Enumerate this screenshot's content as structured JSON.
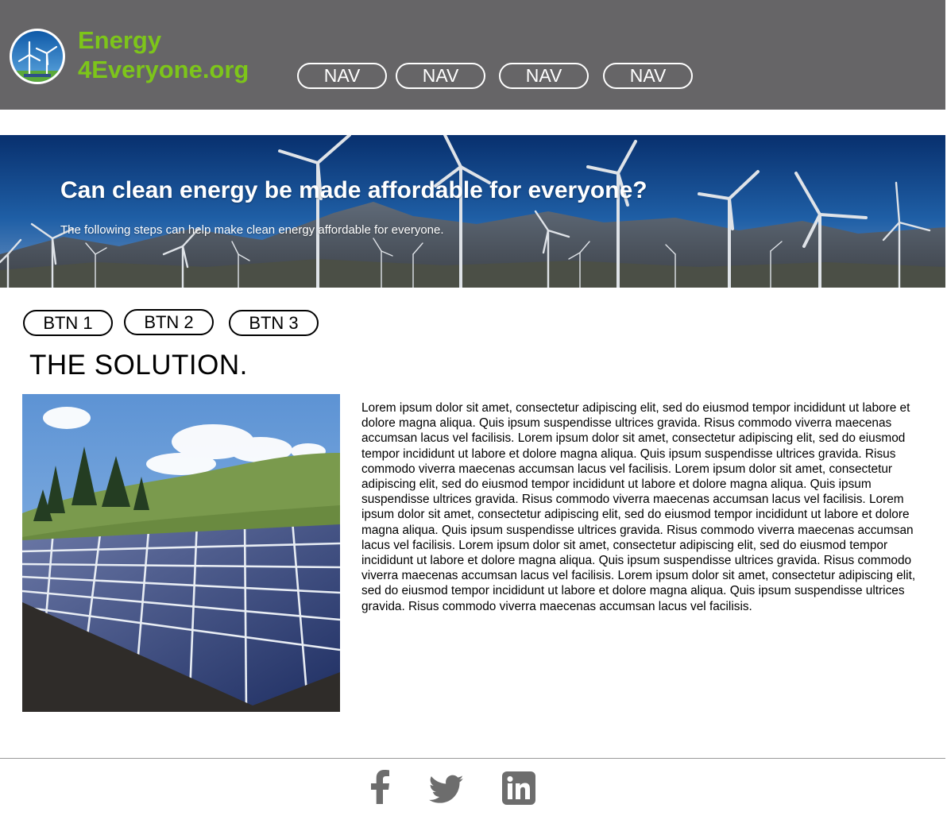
{
  "header": {
    "brand_line1": "Energy",
    "brand_line2": "4Everyone.org",
    "brand_color": "#7dc51a",
    "background": "#666567",
    "nav": [
      "NAV",
      "NAV",
      "NAV",
      "NAV"
    ]
  },
  "hero": {
    "title": "Can clean energy be made affordable for everyone?",
    "subtitle": "The following steps can help make clean energy affordable for everyone."
  },
  "buttons": [
    "BTN 1",
    "BTN 2",
    "BTN 3"
  ],
  "section": {
    "title": "THE SOLUTION.",
    "body": "Lorem ipsum dolor sit amet, consectetur adipiscing elit, sed do eiusmod tempor incididunt ut labore et dolore magna aliqua. Quis ipsum suspendisse ultrices gravida. Risus commodo viverra maecenas accumsan lacus vel facilisis. Lorem ipsum dolor sit amet, consectetur adipiscing elit, sed do eiusmod tempor incididunt ut labore et dolore magna aliqua. Quis ipsum suspendisse ultrices gravida. Risus commodo viverra maecenas accumsan lacus vel facilisis. Lorem ipsum dolor sit amet, consectetur adipiscing elit, sed do eiusmod tempor incididunt ut labore et dolore magna aliqua. Quis ipsum suspendisse ultrices gravida. Risus commodo viverra maecenas accumsan lacus vel facilisis. Lorem ipsum dolor sit amet, consectetur adipiscing elit, sed do eiusmod tempor incididunt ut labore et dolore magna aliqua. Quis ipsum suspendisse ultrices gravida. Risus commodo viverra maecenas accumsan lacus vel facilisis. Lorem ipsum dolor sit amet, consectetur adipiscing elit, sed do eiusmod tempor incididunt ut labore et dolore magna aliqua. Quis ipsum suspendisse ultrices gravida. Risus commodo viverra maecenas accumsan lacus vel facilisis. Lorem ipsum dolor sit amet, consectetur adipiscing elit, sed do eiusmod tempor incididunt ut labore et dolore magna aliqua. Quis ipsum suspendisse ultrices gravida. Risus commodo viverra maecenas accumsan lacus vel facilisis."
  },
  "images": {
    "logo": "wind-turbine-logo",
    "hero": "wind-farm-photo",
    "solution": "solar-panel-photo"
  },
  "footer": {
    "social_icons": [
      "facebook-icon",
      "twitter-icon",
      "linkedin-icon"
    ],
    "icon_color": "#6d6d6d"
  }
}
